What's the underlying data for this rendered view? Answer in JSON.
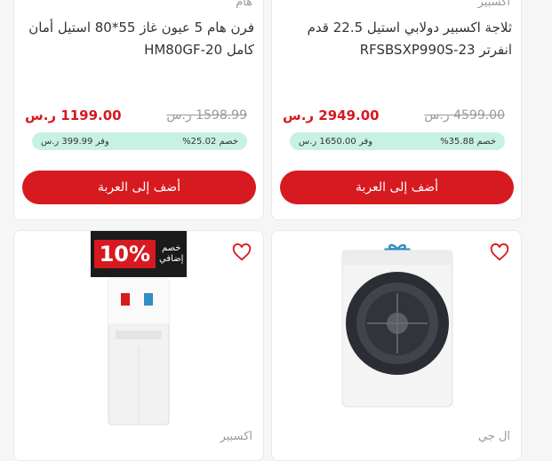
{
  "products": [
    {
      "brand": "اكسبير",
      "title": "ثلاجة اكسبير دولابي استيل 22.5 قدم انفرتر RFSBSXP990S-23",
      "price": "2949.00 ر.س",
      "old_price": "4599.00 ر.س",
      "discount": "خصم 35.88%",
      "savings": "وفر 1650.00 ر.س",
      "add_to_cart": "أضف إلى العربة"
    },
    {
      "brand": "هام",
      "title": "فرن هام 5 عيون غاز 55*80 استيل أمان كامل HM80GF-20",
      "price": "1199.00 ر.س",
      "old_price": "1598.99 ر.س",
      "discount": "خصم 25.02%",
      "savings": "وفر 399.99 ر.س",
      "add_to_cart": "أضف إلى العربة"
    },
    {
      "brand": "ال جي",
      "image": "white-front-load-dryer",
      "gift_icon": "gift-icon"
    },
    {
      "brand": "اكسبير",
      "image": "white-water-dispenser",
      "promo_badge": {
        "percent": "10%",
        "line1": "خصم",
        "line2": "إضافي"
      }
    }
  ],
  "colors": {
    "accent": "#d71920",
    "savings_pill": "#c8f1e6",
    "gift": "#2f8fc2"
  }
}
